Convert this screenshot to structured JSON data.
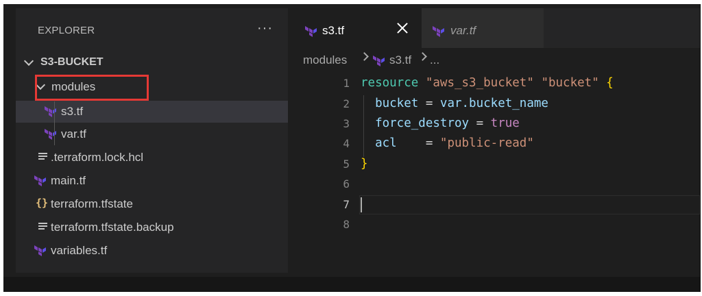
{
  "explorer": {
    "title": "EXPLORER",
    "more": "···",
    "folder": "S3-BUCKET",
    "items": [
      {
        "label": "modules",
        "type": "folder"
      },
      {
        "label": "s3.tf",
        "type": "terraform"
      },
      {
        "label": "var.tf",
        "type": "terraform"
      },
      {
        "label": ".terraform.lock.hcl",
        "type": "lines"
      },
      {
        "label": "main.tf",
        "type": "terraform"
      },
      {
        "label": "terraform.tfstate",
        "type": "json"
      },
      {
        "label": "terraform.tfstate.backup",
        "type": "lines"
      },
      {
        "label": "variables.tf",
        "type": "terraform"
      }
    ],
    "json_icon": "{}"
  },
  "tabs": [
    {
      "label": "s3.tf",
      "active": true
    },
    {
      "label": "var.tf",
      "active": false
    }
  ],
  "breadcrumb": {
    "folder": "modules",
    "file": "s3.tf",
    "more": "..."
  },
  "editor": {
    "line_numbers": [
      "1",
      "2",
      "3",
      "4",
      "5",
      "6",
      "7",
      "8"
    ],
    "current_line": 7,
    "code": {
      "l1_kw": "resource",
      "l1_s1": "\"aws_s3_bucket\"",
      "l1_s2": "\"bucket\"",
      "l1_brace": "{",
      "l2_key": "bucket",
      "l2_eq": " = ",
      "l2_val": "var.bucket_name",
      "l3_key": "force_destroy",
      "l3_eq": " = ",
      "l3_val": "true",
      "l4_key": "acl",
      "l4_eq": "    = ",
      "l4_val": "\"public-read\"",
      "l5_brace": "}"
    }
  },
  "colors": {
    "terraform_icon": "#7b42bc",
    "highlight_box": "#e53935",
    "keyword": "#4ec9b0",
    "string": "#ce9178"
  },
  "icons": [
    "ellipsis-icon",
    "chevron-down-icon",
    "terraform-icon",
    "file-lines-icon",
    "json-braces-icon",
    "close-icon",
    "chevron-right-icon"
  ]
}
